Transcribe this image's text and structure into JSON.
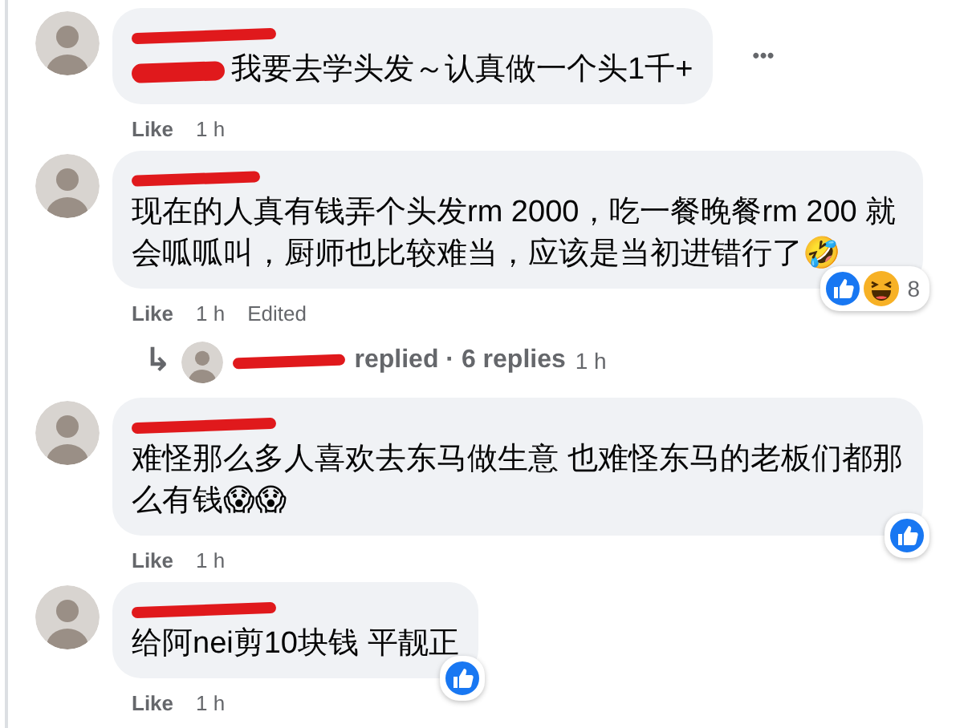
{
  "comments": [
    {
      "name_redacted": true,
      "mention_redacted": true,
      "text": "我要去学头发～认真做一个头1千+",
      "more": "•••",
      "actions": {
        "like": "Like",
        "time": "1 h"
      }
    },
    {
      "name_redacted": true,
      "mention_redacted": false,
      "text": "现在的人真有钱弄个头发rm 2000，吃一餐晚餐rm 200 就会呱呱叫，厨师也比较难当，应该是当初进错行了🤣",
      "actions": {
        "like": "Like",
        "time": "1 h",
        "edited": "Edited"
      },
      "reactions": {
        "icons": [
          {
            "kind": "like"
          },
          {
            "kind": "haha"
          }
        ],
        "count": "8"
      },
      "reply_summary": {
        "arrow": "↳",
        "name_redacted": true,
        "text": "replied · 6 replies",
        "time": "1 h"
      }
    },
    {
      "name_redacted": true,
      "mention_redacted": false,
      "text": "难怪那么多人喜欢去东马做生意 也难怪东马的老板们都那么有钱😱😱",
      "actions": {
        "like": "Like",
        "time": "1 h"
      },
      "reactions": {
        "icons": [
          {
            "kind": "like"
          }
        ]
      }
    },
    {
      "name_redacted": true,
      "mention_redacted": false,
      "text": "给阿nei剪10块钱 平靓正",
      "actions": {
        "like": "Like",
        "time": "1 h"
      },
      "reactions": {
        "icons": [
          {
            "kind": "like"
          }
        ]
      }
    }
  ]
}
